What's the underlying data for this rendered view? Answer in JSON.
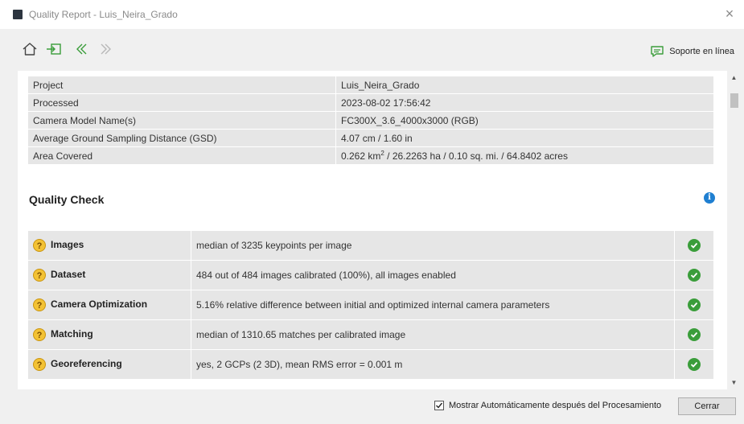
{
  "window": {
    "title": "Quality Report - Luis_Neira_Grado",
    "close_glyph": "×"
  },
  "toolbar": {
    "support_label": "Soporte en línea",
    "icons": [
      "home-icon",
      "export-icon",
      "back-icon",
      "forward-icon",
      "chat-icon"
    ]
  },
  "summary": {
    "rows": [
      {
        "label": "Project",
        "value": "Luis_Neira_Grado"
      },
      {
        "label": "Processed",
        "value": "2023-08-02 17:56:42"
      },
      {
        "label": "Camera Model Name(s)",
        "value": "FC300X_3.6_4000x3000 (RGB)"
      },
      {
        "label": "Average Ground Sampling Distance (GSD)",
        "value": "4.07 cm / 1.60 in"
      },
      {
        "label": "Area Covered",
        "value_prefix": "0.262 km",
        "value_sup": "2",
        "value_suffix": " / 26.2263 ha / 0.10 sq. mi. / 64.8402 acres"
      }
    ]
  },
  "quality_check": {
    "title": "Quality Check",
    "info_glyph": "i",
    "question_glyph": "?",
    "rows": [
      {
        "name": "Images",
        "description": "median of 3235 keypoints per image",
        "status": "ok"
      },
      {
        "name": "Dataset",
        "description": "484 out of 484 images calibrated (100%), all images enabled",
        "status": "ok"
      },
      {
        "name": "Camera Optimization",
        "description": "5.16% relative difference between initial and optimized internal camera parameters",
        "status": "ok"
      },
      {
        "name": "Matching",
        "description": "median of 1310.65 matches per calibrated image",
        "status": "ok"
      },
      {
        "name": "Georeferencing",
        "description": "yes, 2 GCPs (2 3D), mean RMS error = 0.001 m",
        "status": "ok"
      }
    ]
  },
  "footer": {
    "auto_show_label": "Mostrar Automáticamente después del Procesamiento",
    "auto_show_checked": true,
    "close_label": "Cerrar"
  },
  "colors": {
    "ok_green": "#3a9d3a",
    "info_blue": "#1f7fd1",
    "warning_yellow": "#f3c234",
    "table_cell": "#e6e6e6"
  }
}
